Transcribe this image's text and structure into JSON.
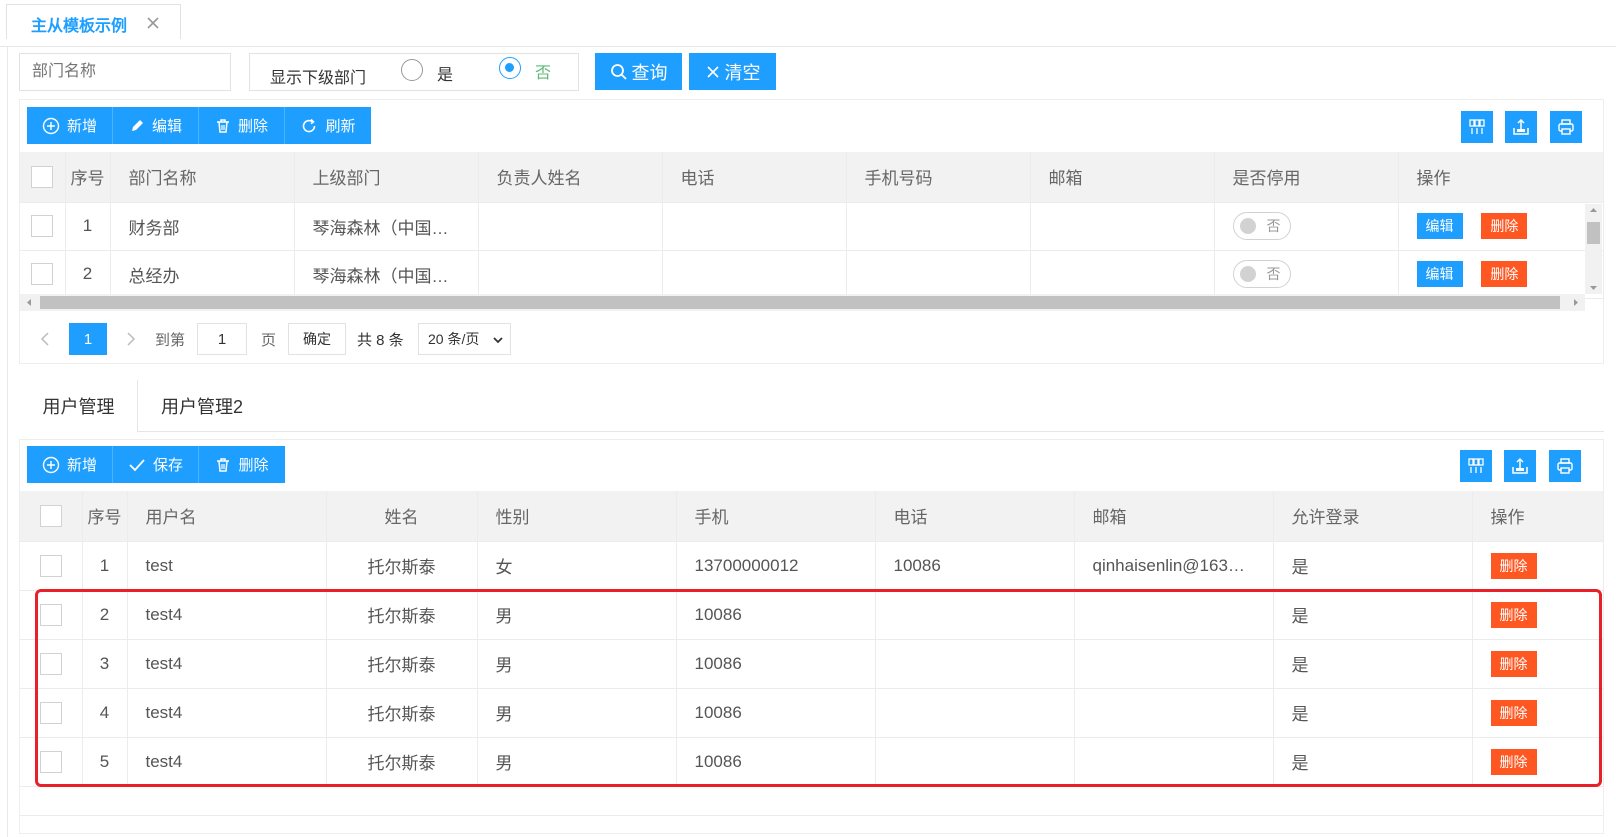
{
  "tab": {
    "title": "主从模板示例"
  },
  "search": {
    "dept_placeholder": "部门名称",
    "show_sub_label": "显示下级部门",
    "radio_yes": "是",
    "radio_no": "否",
    "query_label": "查询",
    "clear_label": "清空"
  },
  "master": {
    "toolbar": {
      "add": "新增",
      "edit": "编辑",
      "delete": "删除",
      "refresh": "刷新"
    },
    "columns": [
      "序号",
      "部门名称",
      "上级部门",
      "负责人姓名",
      "电话",
      "手机号码",
      "邮箱",
      "是否停用",
      "操作"
    ],
    "rows": [
      {
        "no": "1",
        "name": "财务部",
        "parent": "琴海森林（中国…",
        "leader": "",
        "phone": "",
        "mobile": "",
        "email": "",
        "disabled": "否",
        "op_edit": "编辑",
        "op_delete": "删除"
      },
      {
        "no": "2",
        "name": "总经办",
        "parent": "琴海森林（中国…",
        "leader": "",
        "phone": "",
        "mobile": "",
        "email": "",
        "disabled": "否",
        "op_edit": "编辑",
        "op_delete": "删除"
      }
    ],
    "pager": {
      "current": "1",
      "goto_label": "到第",
      "goto_value": "1",
      "page_unit": "页",
      "confirm": "确定",
      "total": "共 8 条",
      "page_size": "20 条/页"
    }
  },
  "subtabs": [
    "用户管理",
    "用户管理2"
  ],
  "detail": {
    "toolbar": {
      "add": "新增",
      "save": "保存",
      "delete": "删除"
    },
    "columns": [
      "序号",
      "用户名",
      "姓名",
      "性别",
      "手机",
      "电话",
      "邮箱",
      "允许登录",
      "操作"
    ],
    "rows": [
      {
        "no": "1",
        "username": "test",
        "name": "托尔斯泰",
        "gender": "女",
        "mobile": "13700000012",
        "phone": "10086",
        "email": "qinhaisenlin@163…",
        "allow": "是",
        "op_delete": "删除"
      },
      {
        "no": "2",
        "username": "test4",
        "name": "托尔斯泰",
        "gender": "男",
        "mobile": "10086",
        "phone": "",
        "email": "",
        "allow": "是",
        "op_delete": "删除"
      },
      {
        "no": "3",
        "username": "test4",
        "name": "托尔斯泰",
        "gender": "男",
        "mobile": "10086",
        "phone": "",
        "email": "",
        "allow": "是",
        "op_delete": "删除"
      },
      {
        "no": "4",
        "username": "test4",
        "name": "托尔斯泰",
        "gender": "男",
        "mobile": "10086",
        "phone": "",
        "email": "",
        "allow": "是",
        "op_delete": "删除"
      },
      {
        "no": "5",
        "username": "test4",
        "name": "托尔斯泰",
        "gender": "男",
        "mobile": "10086",
        "phone": "",
        "email": "",
        "allow": "是",
        "op_delete": "删除"
      }
    ]
  },
  "colors": {
    "primary": "#1E9FFF",
    "danger": "#FF5722",
    "highlight": "#e8202a"
  },
  "icons": [
    "close-icon",
    "search-icon",
    "clear-icon",
    "plus-circle-icon",
    "pencil-icon",
    "trash-icon",
    "refresh-icon",
    "columns-icon",
    "export-icon",
    "print-icon",
    "check-icon",
    "chevron-left-icon",
    "chevron-right-icon",
    "chevron-down-icon"
  ]
}
